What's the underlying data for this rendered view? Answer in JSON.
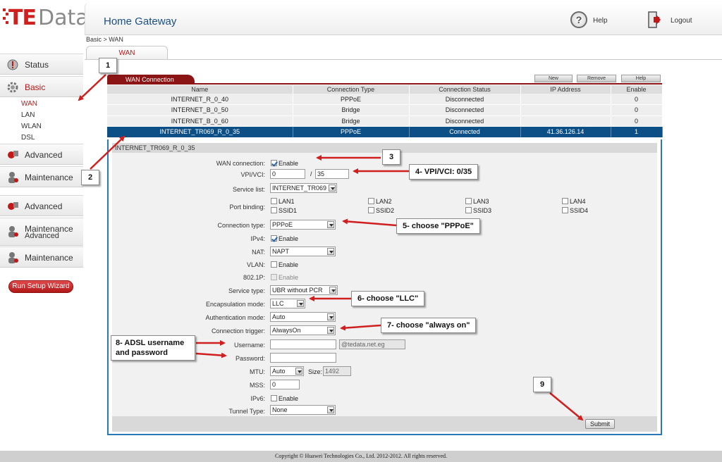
{
  "brand": {
    "te": "TE",
    "data": "Data"
  },
  "header": {
    "title": "Home Gateway",
    "help_label": "Help",
    "logout_label": "Logout",
    "help_glyph": "?"
  },
  "breadcrumb": "Basic > WAN",
  "tab": "WAN",
  "sidebar": {
    "status": "Status",
    "basic": "Basic",
    "basic_sub": [
      "WAN",
      "LAN",
      "WLAN",
      "DSL"
    ],
    "advanced": "Advanced",
    "maintenance": "Maintenance",
    "advanced2": "Advanced",
    "maintenance_stack": [
      "Maintenance",
      "Advanced"
    ],
    "maintenance3": "Maintenance",
    "setup_wizard": "Run Setup Wizard"
  },
  "wan": {
    "section_title": "WAN Connection",
    "buttons": {
      "new": "New",
      "remove": "Remove",
      "help": "Help"
    },
    "columns": [
      "Name",
      "Connection Type",
      "Connection Status",
      "IP Address",
      "Enable"
    ],
    "rows": [
      [
        "INTERNET_R_0_40",
        "PPPoE",
        "Disconnected",
        "",
        "0"
      ],
      [
        "INTERNET_B_0_50",
        "Bridge",
        "Disconnected",
        "",
        "0"
      ],
      [
        "INTERNET_B_0_60",
        "Bridge",
        "Disconnected",
        "",
        "0"
      ],
      [
        "INTERNET_TR069_R_0_35",
        "PPPoE",
        "Connected",
        "41.36.126.14",
        "1"
      ]
    ]
  },
  "detail": {
    "title": "INTERNET_TR069_R_0_35",
    "labels": {
      "wan_connection": "WAN connection:",
      "vpi_vci": "VPI/VCI:",
      "service_list": "Service list:",
      "port_binding": "Port binding:",
      "connection_type": "Connection type:",
      "ipv4": "IPv4:",
      "nat": "NAT:",
      "vlan": "VLAN:",
      "dot1p": "802.1P:",
      "service_type": "Service type:",
      "encapsulation": "Encapsulation mode:",
      "authentication": "Authentication mode:",
      "trigger": "Connection trigger:",
      "username": "Username:",
      "password": "Password:",
      "mtu": "MTU:",
      "size": "Size:",
      "mss": "MSS:",
      "ipv6": "IPv6:",
      "tunnel": "Tunnel Type:"
    },
    "enable_text": "Enable",
    "vpi": "0",
    "vci_sep": "/",
    "vci": "35",
    "service_list": "INTERNET_TR069",
    "ports": [
      "LAN1",
      "LAN2",
      "LAN3",
      "LAN4",
      "SSID1",
      "SSID2",
      "SSID3",
      "SSID4"
    ],
    "connection_type": "PPPoE",
    "nat": "NAPT",
    "service_type": "UBR without PCR",
    "encapsulation": "LLC",
    "authentication": "Auto",
    "trigger": "AlwaysOn",
    "username": "",
    "domain_suffix": "@tedata.net.eg",
    "password": "",
    "mtu": "Auto",
    "size": "1492",
    "mss": "0",
    "tunnel": "None",
    "submit": "Submit"
  },
  "annotations": {
    "n1": "1",
    "n2": "2",
    "n3": "3",
    "n9": "9",
    "vpi_note": "4- VPI/VCI: 0/35",
    "pppoe_note": "5- choose \"PPPoE\"",
    "llc_note": "6- choose \"LLC\"",
    "always_note": "7- choose \"always on\"",
    "adsl_note_1": "8- ADSL username",
    "adsl_note_2": "and password"
  },
  "footer": "Copyright © Huawei Technologies Co., Ltd. 2012-2012. All rights reserved.",
  "colors": {
    "accent_red": "#b31b1b",
    "selected_row": "#0c4f86",
    "section_bar": "#8b1414",
    "title_blue": "#1a4f86"
  }
}
